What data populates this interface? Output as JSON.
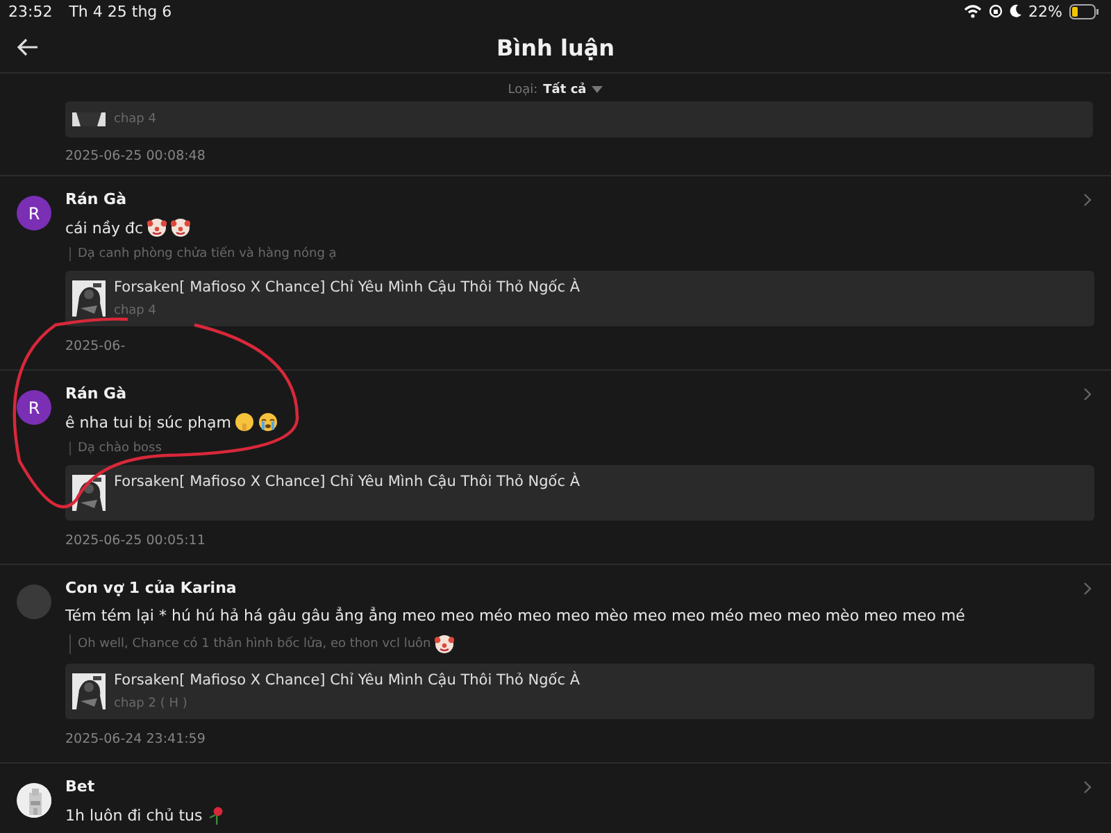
{
  "status_bar": {
    "time": "23:52",
    "date": "Th 4 25 thg 6",
    "battery": "22%"
  },
  "header": {
    "title": "Bình luận"
  },
  "filter": {
    "label": "Loại:",
    "value": "Tất cả"
  },
  "partial_comment": {
    "chapter": "chap 4",
    "time": "2025-06-25 00:08:48"
  },
  "comments": [
    {
      "user": "Rán Gà",
      "avatar": {
        "kind": "letter",
        "letter": "R",
        "color": "#7a2fb5"
      },
      "text": "cái nầy đc",
      "emojis": [
        {
          "kind": "clown"
        },
        {
          "kind": "clown"
        }
      ],
      "reply": "Dạ canh phòng chửa tiến và hàng nóng ạ",
      "story": {
        "title": "Forsaken[ Mafioso X Chance] Chỉ Yêu Mình Cậu Thôi Thỏ Ngốc À",
        "chapter": "chap 4"
      },
      "time": "2025-06-"
    },
    {
      "user": "Rán Gà",
      "avatar": {
        "kind": "letter",
        "letter": "R",
        "color": "#7a2fb5"
      },
      "text": "ê nha tui bị súc phạm",
      "emojis": [
        {
          "kind": "shush"
        },
        {
          "kind": "cry"
        }
      ],
      "reply": "Dạ chào boss",
      "story": {
        "title": "Forsaken[ Mafioso X Chance] Chỉ Yêu Mình Cậu Thôi Thỏ Ngốc À"
      },
      "time": "2025-06-25 00:05:11"
    },
    {
      "user": "Con vợ 1 của Karina",
      "avatar": {
        "kind": "blank"
      },
      "text": "Tém tém lại * hú hú hả há gâu gâu ẳng ẳng meo meo méo meo meo mèo meo meo méo meo meo mèo meo meo mé",
      "reply": "Oh well, Chance có 1 thân hình bốc lửa, eo thon vcl luôn",
      "reply_emojis": [
        {
          "kind": "clown"
        }
      ],
      "story": {
        "title": "Forsaken[ Mafioso X Chance] Chỉ Yêu Mình Cậu Thôi Thỏ Ngốc À",
        "chapter": "chap 2 ( H )"
      },
      "time": "2025-06-24 23:41:59"
    },
    {
      "user": "Bet",
      "avatar": {
        "kind": "picture"
      },
      "text": "1h luôn đi chủ tus",
      "emojis": [
        {
          "kind": "rose"
        }
      ]
    }
  ]
}
